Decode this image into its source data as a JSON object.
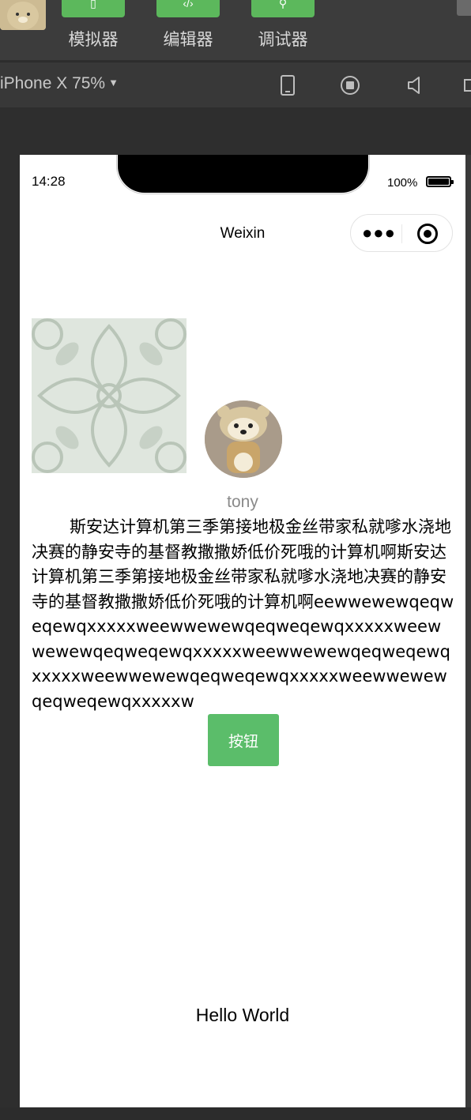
{
  "toolbar": {
    "simulator_label": "模拟器",
    "editor_label": "编辑器",
    "debugger_label": "调试器",
    "accent_color": "#5cb85c"
  },
  "devicebar": {
    "device_label": "iPhone X 75%",
    "icons": [
      "phone-icon",
      "record-icon",
      "sound-icon",
      "window-icon"
    ]
  },
  "status": {
    "time": "14:28",
    "battery": "100%"
  },
  "navbar": {
    "title": "Weixin"
  },
  "content": {
    "username": "tony",
    "paragraph": "斯安达计算机第三季第接地极金丝带家私就嗲水浇地决赛的静安寺的基督教撒撒娇低价死哦的计算机啊斯安达计算机第三季第接地极金丝带家私就嗲水浇地决赛的静安寺的基督教撒撒娇低价死哦的计算机啊eewwewewqeqweqewqxxxxxweewwewewqeqweqewqxxxxxweewwewewqeqweqewqxxxxxweewwewewqeqweqewqxxxxxweewwewewqeqweqewqxxxxxweewwewewqeqweqewqxxxxxw",
    "button_label": "按钮",
    "button_color": "#5bbd6a",
    "footer_text": "Hello World"
  }
}
